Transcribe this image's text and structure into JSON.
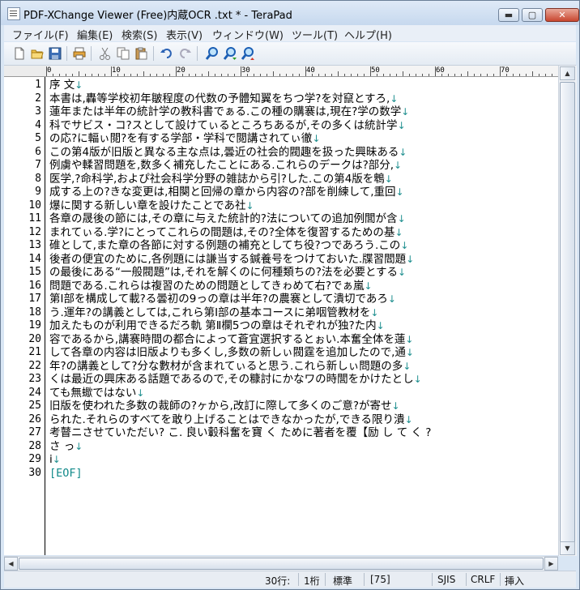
{
  "window": {
    "title": "PDF-XChange Viewer (Free)内蔵OCR  .txt * - TeraPad"
  },
  "title_buttons": {
    "minimize": "▬",
    "maximize": "▢",
    "close": "✕"
  },
  "menu": [
    "ファイル(F)",
    "編集(E)",
    "検索(S)",
    "表示(V)",
    "ウィンドウ(W)",
    "ツール(T)",
    "ヘルプ(H)"
  ],
  "toolbar": [
    "new-file-icon",
    "open-folder-icon",
    "save-icon",
    "print-icon",
    "cut-icon",
    "copy-icon",
    "paste-icon",
    "undo-icon",
    "redo-icon",
    "find-icon",
    "find-next-icon",
    "find-prev-icon"
  ],
  "ruler": {
    "labels": [
      "0",
      "10",
      "20",
      "30",
      "40",
      "50",
      "60",
      "70"
    ]
  },
  "editor": {
    "lines": [
      "序 文",
      "本書は,轟等学校初年皺程度の代数の予體知翼をちつ学?を対竄とすろ,",
      "蓮年または半年の統計学の教科書でぁる.この種の購褰は,現在?学の数学",
      "科でサビス・コ?スとして設けてぃるところちあるが,その多くは統計学",
      "の応?に輻ぃ閲?を有する学部・学科で閲講されてぃ徹",
      "この第4版が旧版と異なる主な点は,曇近の社会的閥趣を扱った興昧ある",
      "例虜や輮習問題を,数多く補充したことにある.これらのデークは?部分,",
      "医学,?命科学,およぴ社会科学分野の雑誌から引?した.この第4版を鵯",
      "成する上の?きな変更は,相闋と回帰の章から内容の?部を削練して,重回",
      "爆に関する新しい章を設けたことであ社",
      "各章の晟後の節には,その章に与えた統計的?法についての追加例閭が含",
      "まれてぃる.学?にとってこれらの間題は,その?全体を復習するための基",
      "碓として,また章の各節に対する例題の補充としてち役?つであろう.この",
      "後者の便宜のために,各例題には謙当する鍼養号をつけておいた.牒習閻題",
      "の最後にある“一般閥題”は,それを解くのに何種類ちの?法を必要とする",
      "問題である.これらは複習のための問題としてきゎめて右?でぁ嵐",
      "第I部を構成して載?る曇初の9っの章は半年?の農褰として潰切であろ",
      "う.運年?の講義としては,これら第I部の基本コースに弟咽管教材を",
      "加えたものが利用できるだろ軌 第Ⅱ欄5つの章はそれぞれが独?た内",
      "容であるから,講褰時間の都合によって蒼宜選択するとぉい.本奮全体を蓮",
      "して各章の内容は旧版よりも多くし,多数の新しぃ閥霆を追加したので,通",
      "年?の講義として?分な數材が含まれてぃると思う.これら新しぃ問題の多",
      "くは最近の興床ある話題であるので,その糠討にかなワの時閭をかけたとし",
      "ても無蠍ではない",
      "旧版を使われた多数の裁師の?ヶから,改訂に際して多くのご意?が寄せ",
      "られた.それらのすべてを敢り上げることはできなかったが,できる限り潰",
      "考瞽ニさせていただい? こ. 良い轂科奮を寶 く ために著者を覆【励 し て く ?",
      "さ っ",
      "i"
    ],
    "newline_marks": [
      true,
      true,
      true,
      true,
      true,
      true,
      true,
      true,
      true,
      true,
      true,
      true,
      true,
      true,
      true,
      true,
      true,
      true,
      true,
      true,
      true,
      true,
      true,
      true,
      true,
      true,
      false,
      true,
      true
    ],
    "eof": "[EOF]"
  },
  "status": {
    "row": "30行:",
    "col": "1桁",
    "mode": "標準",
    "count": "[75]",
    "encoding": "SJIS",
    "linebreak": "CRLF",
    "insert": "挿入"
  }
}
